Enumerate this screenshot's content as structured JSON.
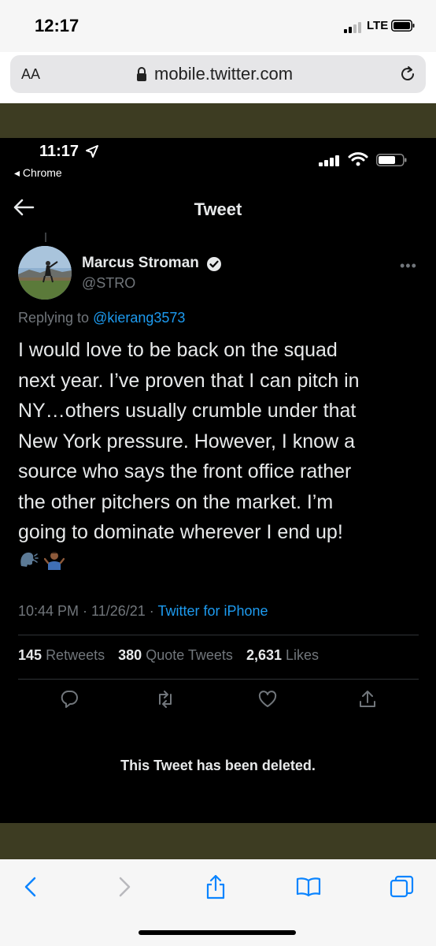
{
  "outer_status": {
    "time": "12:17",
    "network": "LTE"
  },
  "address_bar": {
    "text_size_label": "AA",
    "url": "mobile.twitter.com"
  },
  "inner_status": {
    "time": "11:17",
    "back_app": "◂ Chrome"
  },
  "nav": {
    "title": "Tweet"
  },
  "tweet": {
    "author_name": "Marcus Stroman",
    "handle": "@STRO",
    "replying_prefix": "Replying to ",
    "replying_to": "@kierang3573",
    "text_lines": [
      "I would love to be back on the squad",
      "next year. I’ve proven that I can pitch in",
      "NY…others usually crumble under that",
      "New York pressure. However, I know a",
      "source who says the front office rather",
      "the other pitchers on the market. I’m",
      "going to dominate wherever I end up!"
    ],
    "emojis": [
      "speaking-head",
      "person-shrugging"
    ],
    "time": "10:44 PM",
    "separator": " · ",
    "date": "11/26/21",
    "source": "Twitter for iPhone"
  },
  "stats": {
    "retweets_count": "145",
    "retweets_label": "Retweets",
    "quotes_count": "380",
    "quotes_label": "Quote Tweets",
    "likes_count": "2,631",
    "likes_label": "Likes"
  },
  "deleted_notice": "This Tweet has been deleted.",
  "icons": {
    "outer": [
      "signal-icon",
      "battery-icon",
      "lock-icon",
      "reload-icon"
    ],
    "inner": [
      "location-arrow-icon",
      "signal-icon",
      "wifi-icon",
      "battery-icon",
      "back-arrow-icon",
      "verified-badge-icon",
      "more-icon"
    ],
    "actions": [
      "reply-icon",
      "retweet-icon",
      "like-icon",
      "share-icon"
    ],
    "toolbar": [
      "back-icon",
      "forward-icon",
      "share-icon",
      "bookmarks-icon",
      "tabs-icon"
    ]
  },
  "colors": {
    "olive_band": "#3d3c22",
    "tweet_background": "#000000",
    "link_blue": "#1d9bf0",
    "secondary_text": "#71767b",
    "safari_blue": "#0a84ff"
  }
}
